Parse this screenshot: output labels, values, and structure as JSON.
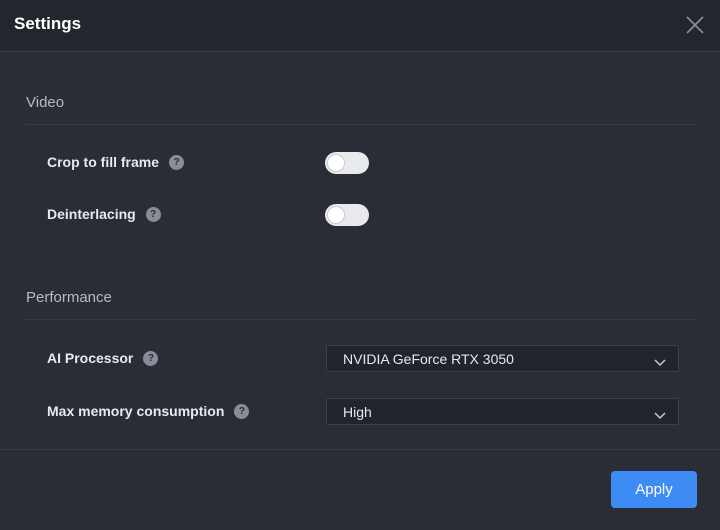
{
  "dialog": {
    "title": "Settings",
    "close_icon": "close-icon"
  },
  "video": {
    "section_title": "Video",
    "crop_label": "Crop to fill frame",
    "crop_enabled": false,
    "deinterlacing_label": "Deinterlacing",
    "deinterlacing_enabled": false
  },
  "performance": {
    "section_title": "Performance",
    "ai_processor_label": "AI Processor",
    "ai_processor_value": "NVIDIA GeForce RTX 3050",
    "max_memory_label": "Max memory consumption",
    "max_memory_value": "High"
  },
  "help_glyph": "?",
  "footer": {
    "apply_label": "Apply"
  },
  "colors": {
    "accent": "#3d8cf5",
    "background": "#2b2d36",
    "header": "#24262d"
  }
}
